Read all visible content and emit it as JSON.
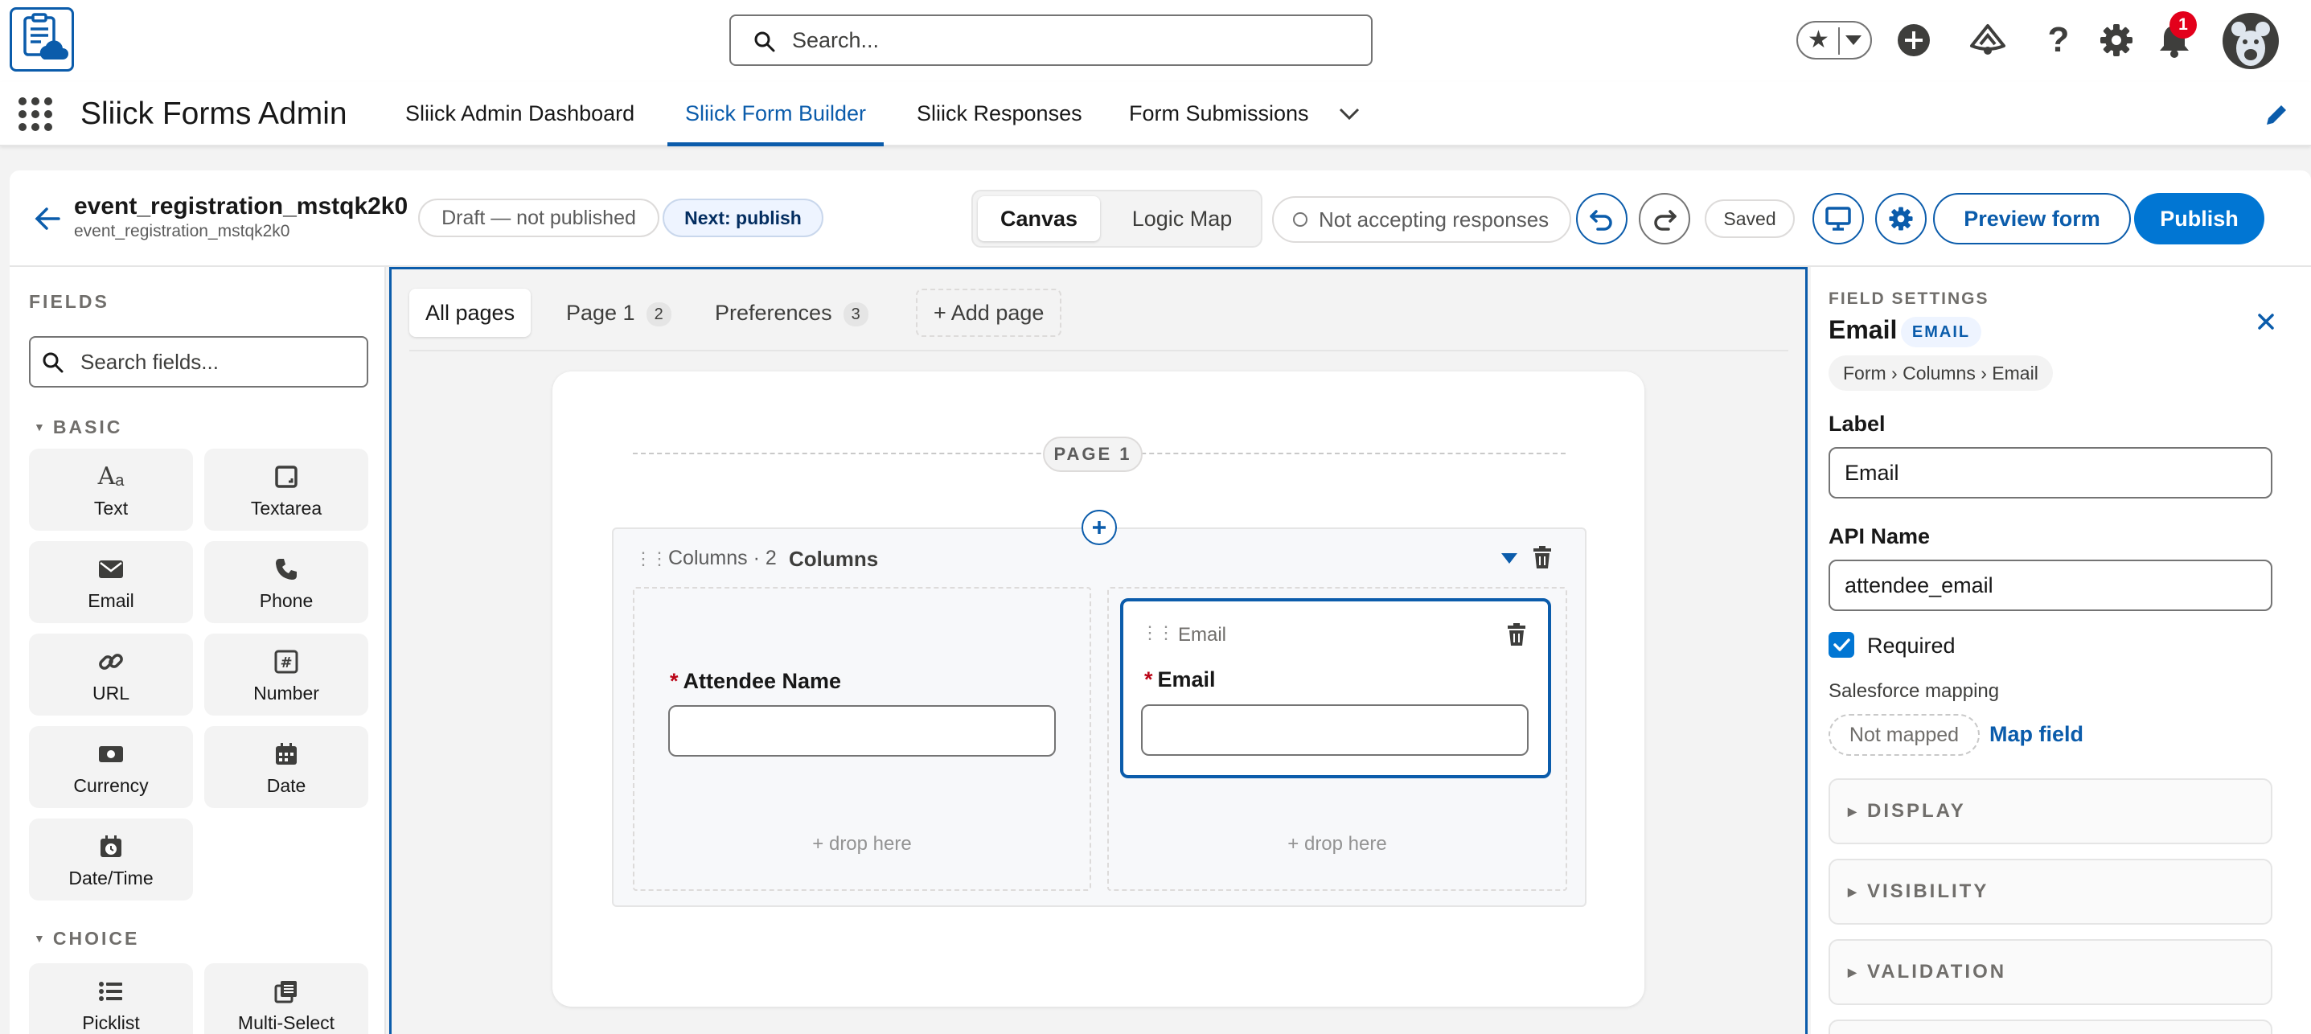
{
  "header": {
    "search_placeholder": "Search...",
    "notification_count": "1"
  },
  "nav": {
    "app_name": "Sliick Forms Admin",
    "tabs": [
      {
        "label": "Sliick Admin Dashboard",
        "active": false
      },
      {
        "label": "Sliick Form Builder",
        "active": true
      },
      {
        "label": "Sliick Responses",
        "active": false
      },
      {
        "label": "Form Submissions",
        "active": false
      }
    ]
  },
  "builder": {
    "form_title": "event_registration_mstqk2k0",
    "form_subtitle": "event_registration_mstqk2k0",
    "status_pill": "Draft — not published",
    "next_pill": "Next: publish",
    "mode_tabs": [
      "Canvas",
      "Logic Map"
    ],
    "active_mode": "Canvas",
    "responses_status": "Not accepting responses",
    "saved_label": "Saved",
    "preview_label": "Preview form",
    "publish_label": "Publish"
  },
  "fields_panel": {
    "title": "FIELDS",
    "search_placeholder": "Search fields...",
    "basic_label": "BASIC",
    "basic_items": [
      {
        "label": "Text",
        "icon": "text-icon"
      },
      {
        "label": "Textarea",
        "icon": "textarea-icon"
      },
      {
        "label": "Email",
        "icon": "email-icon"
      },
      {
        "label": "Phone",
        "icon": "phone-icon"
      },
      {
        "label": "URL",
        "icon": "link-icon"
      },
      {
        "label": "Number",
        "icon": "number-icon"
      },
      {
        "label": "Currency",
        "icon": "currency-icon"
      },
      {
        "label": "Date",
        "icon": "calendar-icon"
      },
      {
        "label": "Date/Time",
        "icon": "datetime-icon"
      }
    ],
    "choice_label": "CHOICE",
    "choice_items": [
      {
        "label": "Picklist",
        "icon": "list-icon"
      },
      {
        "label": "Multi-Select",
        "icon": "multi-select-icon"
      }
    ]
  },
  "canvas": {
    "page_tabs": [
      {
        "label": "All pages",
        "count": ""
      },
      {
        "label": "Page 1",
        "count": "2"
      },
      {
        "label": "Preferences",
        "count": "3"
      }
    ],
    "add_page_label": "+ Add page",
    "page_divider_label": "PAGE 1",
    "columns_type": "Columns · 2",
    "columns_name": "Columns",
    "left_field_label": "Attendee Name",
    "right_field_type": "Email",
    "right_field_label": "Email",
    "drop_here": "+ drop here",
    "required_marker": "*"
  },
  "settings": {
    "section_title": "FIELD SETTINGS",
    "field_name": "Email",
    "field_type_badge": "EMAIL",
    "breadcrumb": "Form › Columns › Email",
    "label_caption": "Label",
    "label_value": "Email",
    "api_caption": "API Name",
    "api_value": "attendee_email",
    "required_label": "Required",
    "required_checked": true,
    "mapping_caption": "Salesforce mapping",
    "mapping_status": "Not mapped",
    "map_field_label": "Map field",
    "accordions": [
      "DISPLAY",
      "VISIBILITY",
      "VALIDATION"
    ]
  },
  "colors": {
    "brand": "#0b5cab",
    "publish_bg": "#0176d3",
    "required": "#ba0517",
    "notification": "#e3001b"
  }
}
